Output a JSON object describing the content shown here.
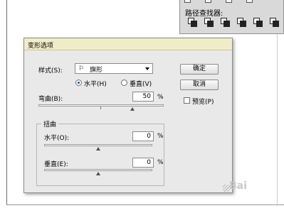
{
  "pathfinder": {
    "title": "路径查找器:"
  },
  "dialog": {
    "title": "变形选项",
    "style_label": "样式(S):",
    "style_value": "旗形",
    "style_flag_glyph": "⚐",
    "horizontal_label": "水平(H)",
    "vertical_label": "垂直(V)",
    "orientation_selected": "horizontal",
    "bend_label": "弯曲(B):",
    "bend_value": "50",
    "percent": "%",
    "distortion_group": "扭曲",
    "dist_horizontal_label": "水平(O):",
    "dist_horizontal_value": "0",
    "dist_vertical_label": "垂直(E):",
    "dist_vertical_value": "0",
    "ok_button": "确定",
    "cancel_button": "取消",
    "preview_label": "预览(P)",
    "preview_checked": false,
    "bend_slider_level": 0.75,
    "dist_h_slider_level": 0.5,
    "dist_v_slider_level": 0.5
  },
  "watermark": "Bai"
}
